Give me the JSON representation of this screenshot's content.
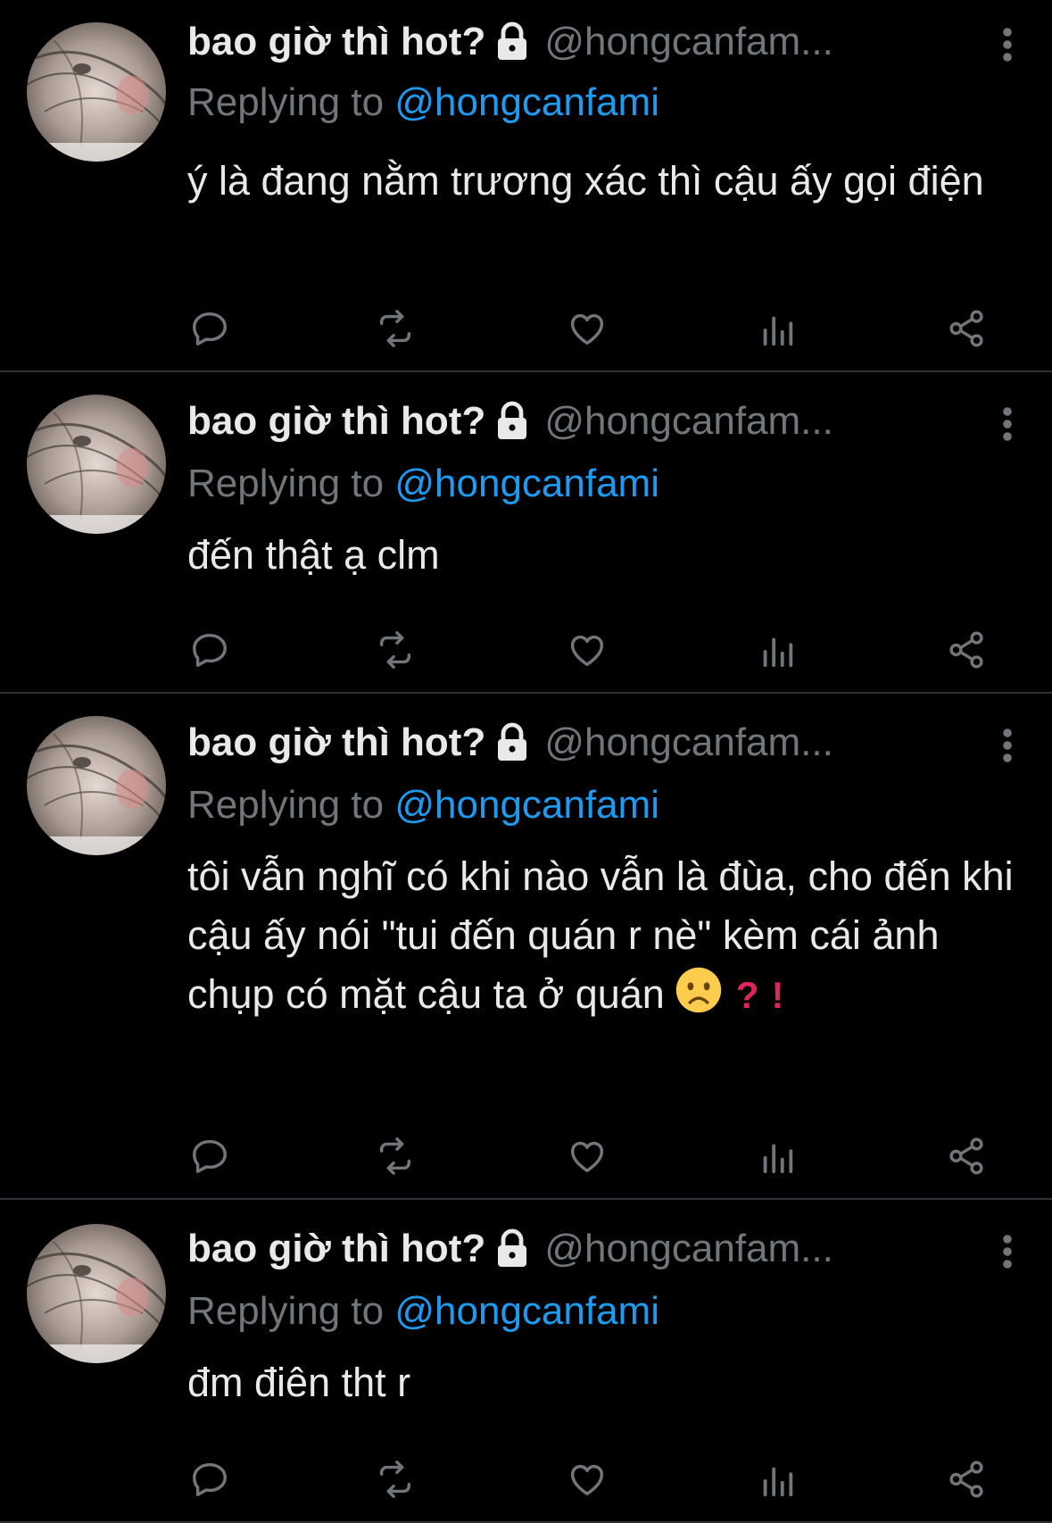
{
  "colors": {
    "background": "#000000",
    "text": "#e7e9ea",
    "secondary": "#71767b",
    "link": "#1d9bf0",
    "divider": "#2f3336"
  },
  "icons": {
    "lock": "lock-icon",
    "more": "more-vertical-icon",
    "reply": "reply-icon",
    "retweet": "retweet-icon",
    "like": "heart-icon",
    "views": "analytics-icon",
    "share": "share-icon"
  },
  "tweets": [
    {
      "name": "bao giờ thì hot?",
      "handle": "@hongcanfam...",
      "replying_prefix": "Replying to ",
      "replying_to": "@hongcanfami",
      "text": "ý là đang nằm trương xác thì cậu ấy gọi điện"
    },
    {
      "name": "bao giờ thì hot?",
      "handle": "@hongcanfam...",
      "replying_prefix": "Replying to ",
      "replying_to": "@hongcanfami",
      "text": "đến thật ạ clm"
    },
    {
      "name": "bao giờ thì hot?",
      "handle": "@hongcanfam...",
      "replying_prefix": "Replying to ",
      "replying_to": "@hongcanfami",
      "text": "tôi vẫn nghĩ có khi nào vẫn là đùa, cho đến khi cậu ấy nói \"tui đến quán r nè\" kèm cái ảnh chụp có mặt cậu ta ở quán",
      "emoji_question": "?",
      "emoji_exclamation": "!"
    },
    {
      "name": "bao giờ thì hot?",
      "handle": "@hongcanfam...",
      "replying_prefix": "Replying to ",
      "replying_to": "@hongcanfami",
      "text": "đm điên tht r"
    }
  ]
}
